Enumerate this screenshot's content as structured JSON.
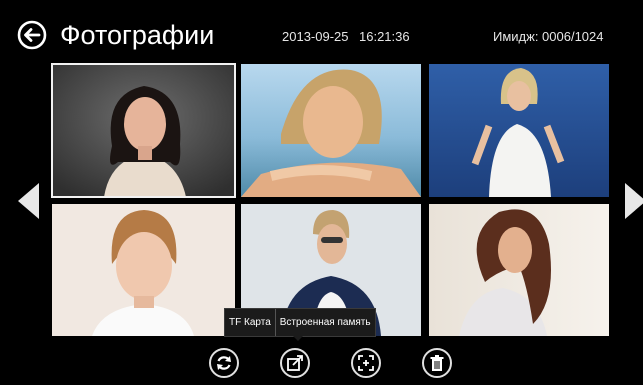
{
  "header": {
    "title": "Фотографии",
    "date": "2013-09-25",
    "time": "16:21:36",
    "image_info": "Имидж: 0006/1024"
  },
  "icons": {
    "back": "back-arrow-circle-icon",
    "prev": "triangle-left-icon",
    "next": "triangle-right-icon",
    "refresh": "refresh-icon",
    "move": "move-to-storage-icon",
    "fullscreen": "fullscreen-icon",
    "delete": "trash-icon"
  },
  "thumbnails": [
    {
      "selected": true
    },
    {
      "selected": false
    },
    {
      "selected": false
    },
    {
      "selected": false
    },
    {
      "selected": false
    },
    {
      "selected": false
    }
  ],
  "storage_menu": {
    "option_tf": "TF Карта",
    "option_internal": "Встроенная память"
  },
  "colors": {
    "background": "#000000",
    "text": "#ffffff",
    "selection_border": "#f2f2f2"
  }
}
